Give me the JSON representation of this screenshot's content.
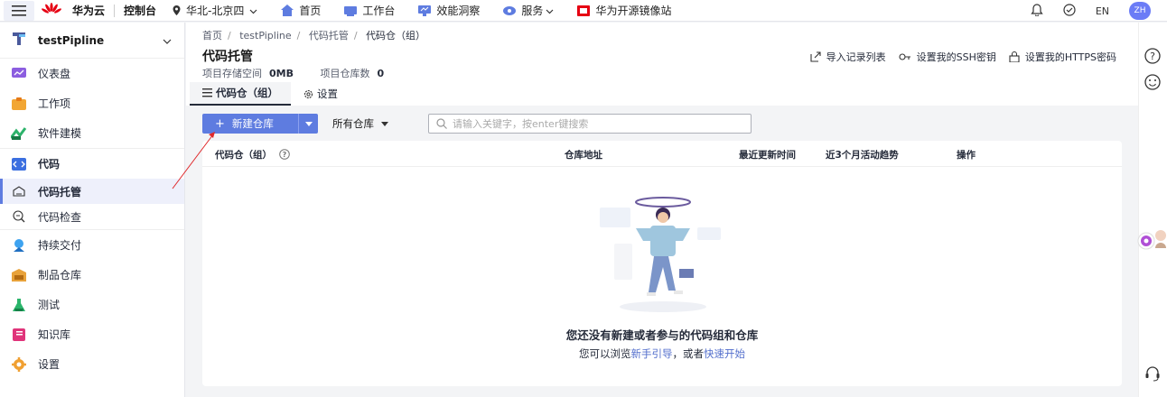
{
  "topbar": {
    "brand": "华为云",
    "brand_sub": "HUAWEI",
    "console": "控制台",
    "region": "华北-北京四",
    "nav": [
      "首页",
      "工作台",
      "效能洞察",
      "服务",
      "华为开源镜像站"
    ],
    "lang": "EN",
    "avatar": "ZH"
  },
  "sidebar": {
    "project": "testPipline",
    "items": {
      "dashboard": "仪表盘",
      "workitems": "工作项",
      "modeling": "软件建模",
      "code": "代码",
      "code_hosting": "代码托管",
      "code_check": "代码检查",
      "delivery": "持续交付",
      "artifacts": "制品仓库",
      "testing": "测试",
      "wiki": "知识库",
      "settings": "设置"
    }
  },
  "breadcrumb": [
    "首页",
    "testPipline",
    "代码托管",
    "代码仓（组）"
  ],
  "page": {
    "title": "代码托管",
    "storage_label": "项目存储空间",
    "storage_value": "0MB",
    "repo_count_label": "项目仓库数",
    "repo_count_value": "0",
    "actions": [
      "导入记录列表",
      "设置我的SSH密钥",
      "设置我的HTTPS密码"
    ],
    "tabs": [
      "代码仓（组）",
      "设置"
    ]
  },
  "toolbar": {
    "new_repo": "新建仓库",
    "filter": "所有仓库",
    "search_placeholder": "请输入关键字，按enter键搜索"
  },
  "table": {
    "columns": [
      "代码仓（组）",
      "仓库地址",
      "最近更新时间",
      "近3个月活动趋势",
      "操作"
    ]
  },
  "empty": {
    "title": "您还没有新建或者参与的代码组和仓库",
    "desc_prefix": "您可以浏览",
    "link1": "新手引导",
    "desc_mid": "，或者",
    "link2": "快速开始"
  },
  "colors": {
    "primary": "#5e7ce0",
    "link": "#526ecc",
    "brand_red": "#e60012"
  }
}
